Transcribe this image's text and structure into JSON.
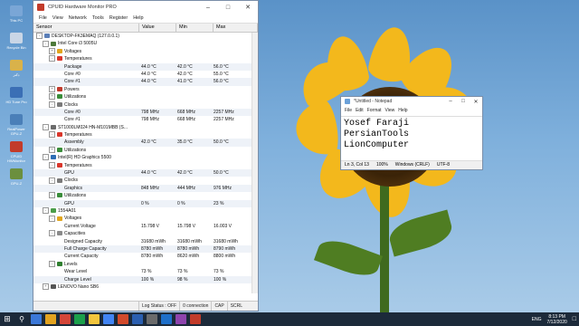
{
  "desktop": {
    "icons": [
      {
        "label": "This PC",
        "color": "#7aa6d6"
      },
      {
        "label": "Recycle Bin",
        "color": "#c9d6e6"
      },
      {
        "label": "دکتر",
        "color": "#d9b24a"
      },
      {
        "label": "HD Tune Pro",
        "color": "#3b6fb5"
      },
      {
        "label": "RealPower GPU-Z",
        "color": "#4a7fb8"
      },
      {
        "label": "CPUID HWMonitor",
        "color": "#c23b2a"
      },
      {
        "label": "GPU-Z",
        "color": "#6b8f3e"
      }
    ]
  },
  "hwmonitor": {
    "title": "CPUID Hardware Monitor PRO",
    "menu": [
      "File",
      "View",
      "Network",
      "Tools",
      "Register",
      "Help"
    ],
    "columns": [
      "Sensor",
      "Value",
      "Min",
      "Max"
    ],
    "rows": [
      {
        "d": 0,
        "exp": "-",
        "icon": "computer",
        "name": "DESKTOP-FK3EMAQ (127.0.0.1)",
        "v": "",
        "mn": "",
        "mx": ""
      },
      {
        "d": 1,
        "exp": "-",
        "icon": "chip",
        "name": "Intel Core i3 5005U",
        "v": "",
        "mn": "",
        "mx": ""
      },
      {
        "d": 2,
        "exp": "+",
        "icon": "voltage",
        "name": "Voltages",
        "v": "",
        "mn": "",
        "mx": ""
      },
      {
        "d": 2,
        "exp": "-",
        "icon": "temp",
        "name": "Temperatures",
        "v": "",
        "mn": "",
        "mx": ""
      },
      {
        "d": 3,
        "exp": "",
        "icon": "",
        "name": "Package",
        "v": "44.0 °C",
        "mn": "42.0 °C",
        "mx": "56.0 °C"
      },
      {
        "d": 3,
        "exp": "",
        "icon": "",
        "name": "Core #0",
        "v": "44.0 °C",
        "mn": "42.0 °C",
        "mx": "55.0 °C"
      },
      {
        "d": 3,
        "exp": "",
        "icon": "",
        "name": "Core #1",
        "v": "44.0 °C",
        "mn": "41.0 °C",
        "mx": "56.0 °C"
      },
      {
        "d": 2,
        "exp": "+",
        "icon": "power",
        "name": "Powers",
        "v": "",
        "mn": "",
        "mx": ""
      },
      {
        "d": 2,
        "exp": "+",
        "icon": "util",
        "name": "Utilizations",
        "v": "",
        "mn": "",
        "mx": ""
      },
      {
        "d": 2,
        "exp": "-",
        "icon": "clock",
        "name": "Clocks",
        "v": "",
        "mn": "",
        "mx": ""
      },
      {
        "d": 3,
        "exp": "",
        "icon": "",
        "name": "Core #0",
        "v": "798 MHz",
        "mn": "668 MHz",
        "mx": "2257 MHz"
      },
      {
        "d": 3,
        "exp": "",
        "icon": "",
        "name": "Core #1",
        "v": "798 MHz",
        "mn": "668 MHz",
        "mx": "2257 MHz"
      },
      {
        "d": 1,
        "exp": "-",
        "icon": "disk",
        "name": "ST1000LM024 HN-M101MBB (S...",
        "v": "",
        "mn": "",
        "mx": ""
      },
      {
        "d": 2,
        "exp": "-",
        "icon": "temp",
        "name": "Temperatures",
        "v": "",
        "mn": "",
        "mx": ""
      },
      {
        "d": 3,
        "exp": "",
        "icon": "",
        "name": "Assembly",
        "v": "42.0 °C",
        "mn": "35.0 °C",
        "mx": "50.0 °C"
      },
      {
        "d": 2,
        "exp": "+",
        "icon": "util",
        "name": "Utilizations",
        "v": "",
        "mn": "",
        "mx": ""
      },
      {
        "d": 1,
        "exp": "-",
        "icon": "gpu",
        "name": "Intel(R) HD Graphics 5500",
        "v": "",
        "mn": "",
        "mx": ""
      },
      {
        "d": 2,
        "exp": "-",
        "icon": "temp",
        "name": "Temperatures",
        "v": "",
        "mn": "",
        "mx": ""
      },
      {
        "d": 3,
        "exp": "",
        "icon": "",
        "name": "GPU",
        "v": "44.0 °C",
        "mn": "42.0 °C",
        "mx": "50.0 °C"
      },
      {
        "d": 2,
        "exp": "-",
        "icon": "clock",
        "name": "Clocks",
        "v": "",
        "mn": "",
        "mx": ""
      },
      {
        "d": 3,
        "exp": "",
        "icon": "",
        "name": "Graphics",
        "v": "848 MHz",
        "mn": "444 MHz",
        "mx": "976 MHz"
      },
      {
        "d": 2,
        "exp": "-",
        "icon": "util",
        "name": "Utilizations",
        "v": "",
        "mn": "",
        "mx": ""
      },
      {
        "d": 3,
        "exp": "",
        "icon": "",
        "name": "GPU",
        "v": "0 %",
        "mn": "0 %",
        "mx": "23 %"
      },
      {
        "d": 1,
        "exp": "-",
        "icon": "battery",
        "name": "1554A01",
        "v": "",
        "mn": "",
        "mx": ""
      },
      {
        "d": 2,
        "exp": "-",
        "icon": "voltage",
        "name": "Voltages",
        "v": "",
        "mn": "",
        "mx": ""
      },
      {
        "d": 3,
        "exp": "",
        "icon": "",
        "name": "Current Voltage",
        "v": "15.798 V",
        "mn": "15.798 V",
        "mx": "16.003 V"
      },
      {
        "d": 2,
        "exp": "-",
        "icon": "capacity",
        "name": "Capacities",
        "v": "",
        "mn": "",
        "mx": ""
      },
      {
        "d": 3,
        "exp": "",
        "icon": "",
        "name": "Designed Capacity",
        "v": "31680 mWh",
        "mn": "31680 mWh",
        "mx": "31680 mWh"
      },
      {
        "d": 3,
        "exp": "",
        "icon": "",
        "name": "Full Charge Capacity",
        "v": "8780 mWh",
        "mn": "8780 mWh",
        "mx": "8790 mWh"
      },
      {
        "d": 3,
        "exp": "",
        "icon": "",
        "name": "Current Capacity",
        "v": "8780 mWh",
        "mn": "8620 mWh",
        "mx": "8800 mWh"
      },
      {
        "d": 2,
        "exp": "-",
        "icon": "level",
        "name": "Levels",
        "v": "",
        "mn": "",
        "mx": ""
      },
      {
        "d": 3,
        "exp": "",
        "icon": "",
        "name": "Wear Level",
        "v": "73 %",
        "mn": "73 %",
        "mx": "73 %"
      },
      {
        "d": 3,
        "exp": "",
        "icon": "",
        "name": "Charge Level",
        "v": "100 %",
        "mn": "98 %",
        "mx": "100 %"
      },
      {
        "d": 1,
        "exp": "+",
        "icon": "device",
        "name": "LENOVO Nano SB6",
        "v": "",
        "mn": "",
        "mx": ""
      }
    ],
    "status": {
      "log": "Log Status : OFF",
      "conn": "0 connection",
      "cap": "CAP",
      "scrl": "SCRL"
    }
  },
  "notepad": {
    "title": "*Untitled - Notepad",
    "menu": [
      "File",
      "Edit",
      "Format",
      "View",
      "Help"
    ],
    "lines": [
      "Yosef Faraji",
      "PersianTools",
      "LionComputer"
    ],
    "status": {
      "pos": "Ln 3, Col 13",
      "zoom": "100%",
      "eol": "Windows (CRLF)",
      "enc": "UTF-8"
    }
  },
  "taskbar": {
    "apps": [
      "#3b78d8",
      "#e3a320",
      "#d44638",
      "#1ba04b",
      "#f2c53d",
      "#4285f4",
      "#d24a2b",
      "#2b5fb0",
      "#6b6b6b",
      "#1e6fc9",
      "#8e44ad",
      "#c23b2a"
    ],
    "tray": {
      "lang": "ENG",
      "time": "8:13 PM",
      "date": "7/12/2020"
    }
  }
}
